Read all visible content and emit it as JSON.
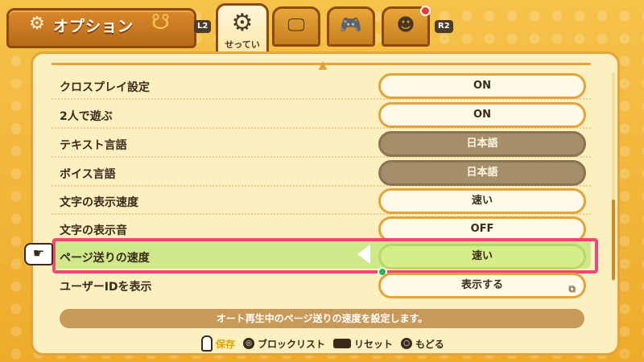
{
  "header": {
    "title": "オプション",
    "left_shoulder": "L2",
    "right_shoulder": "R2",
    "tabs": [
      {
        "id": "settings",
        "label": "せってい",
        "active": true,
        "icon": "gear-icon"
      },
      {
        "id": "display",
        "label": "",
        "active": false,
        "icon": "monitor-icon"
      },
      {
        "id": "controller",
        "label": "",
        "active": false,
        "icon": "gamepad-icon"
      },
      {
        "id": "character",
        "label": "",
        "active": false,
        "icon": "character-icon",
        "notify": true
      }
    ]
  },
  "rows": [
    {
      "label": "クロスプレイ設定",
      "value": "ON",
      "state": "normal"
    },
    {
      "label": "2人で遊ぶ",
      "value": "ON",
      "state": "normal"
    },
    {
      "label": "テキスト言語",
      "value": "日本語",
      "state": "disabled"
    },
    {
      "label": "ボイス言語",
      "value": "日本語",
      "state": "disabled"
    },
    {
      "label": "文字の表示速度",
      "value": "速い",
      "state": "normal"
    },
    {
      "label": "文字の表示音",
      "value": "OFF",
      "state": "normal"
    },
    {
      "label": "ページ送りの速度",
      "value": "速い",
      "state": "selected"
    },
    {
      "label": "ユーザーIDを表示",
      "value": "表示する",
      "state": "normal"
    }
  ],
  "description": "オート再生中のページ送りの速度を設定します。",
  "hints": {
    "save": "保存",
    "block_list": "ブロックリスト",
    "reset": "リセット",
    "back": "もどる"
  }
}
